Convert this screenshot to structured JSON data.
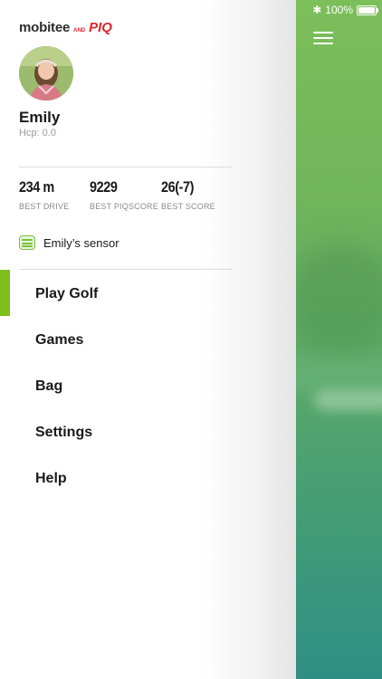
{
  "status_bar": {
    "bluetooth_icon": "bluetooth-icon",
    "battery_percent": "100%",
    "battery_icon": "battery-full-icon"
  },
  "logo": {
    "brand": "mobitee",
    "conjunction": "AND",
    "partner": "PIQ",
    "partner_color": "#d9262b"
  },
  "profile": {
    "name": "Emily",
    "hcp": "Hcp: 0.0"
  },
  "stats": [
    {
      "value": "234 m",
      "label": "BEST DRIVE"
    },
    {
      "value": "9229",
      "label": "BEST PIQSCORE"
    },
    {
      "value": "26(-7)",
      "label": "BEST SCORE"
    }
  ],
  "sensor": {
    "label": "Emily’s sensor",
    "icon": "sensor-icon"
  },
  "menu": {
    "items": [
      {
        "label": "Play Golf",
        "active": true
      },
      {
        "label": "Games"
      },
      {
        "label": "Bag"
      },
      {
        "label": "Settings"
      },
      {
        "label": "Help"
      }
    ]
  },
  "colors": {
    "accent": "#7cbe1c",
    "background_top": "#7cbe5a",
    "background_bottom": "#2f8f84"
  }
}
